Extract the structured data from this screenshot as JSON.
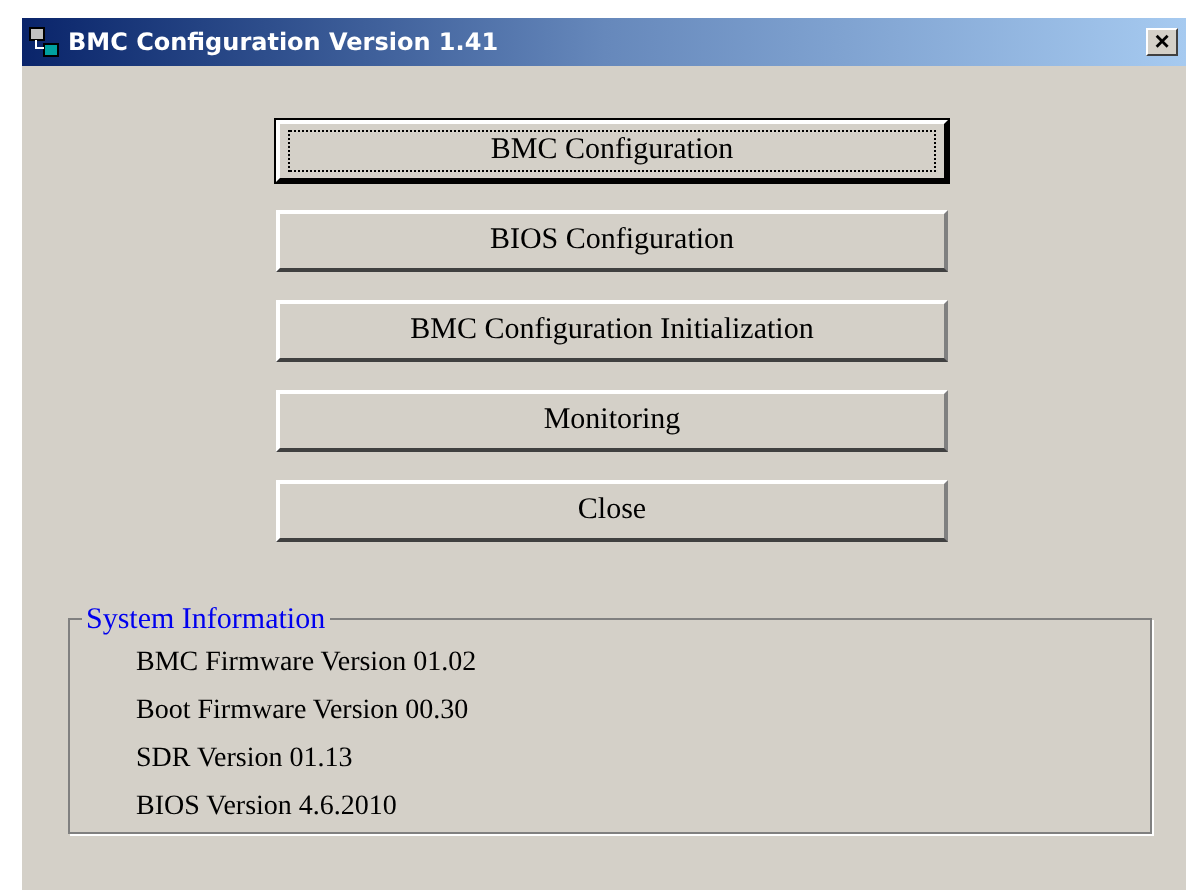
{
  "window": {
    "title": "BMC Configuration Version 1.41",
    "close_glyph": "×"
  },
  "buttons": [
    {
      "label": "BMC Configuration",
      "focused": true
    },
    {
      "label": "BIOS Configuration",
      "focused": false
    },
    {
      "label": "BMC Configuration Initialization",
      "focused": false
    },
    {
      "label": "Monitoring",
      "focused": false
    },
    {
      "label": "Close",
      "focused": false
    }
  ],
  "system_information": {
    "title": "System Information",
    "lines": [
      "BMC Firmware Version 01.02",
      "Boot Firmware Version 00.30",
      "SDR Version 01.13",
      "BIOS Version 4.6.2010"
    ]
  }
}
